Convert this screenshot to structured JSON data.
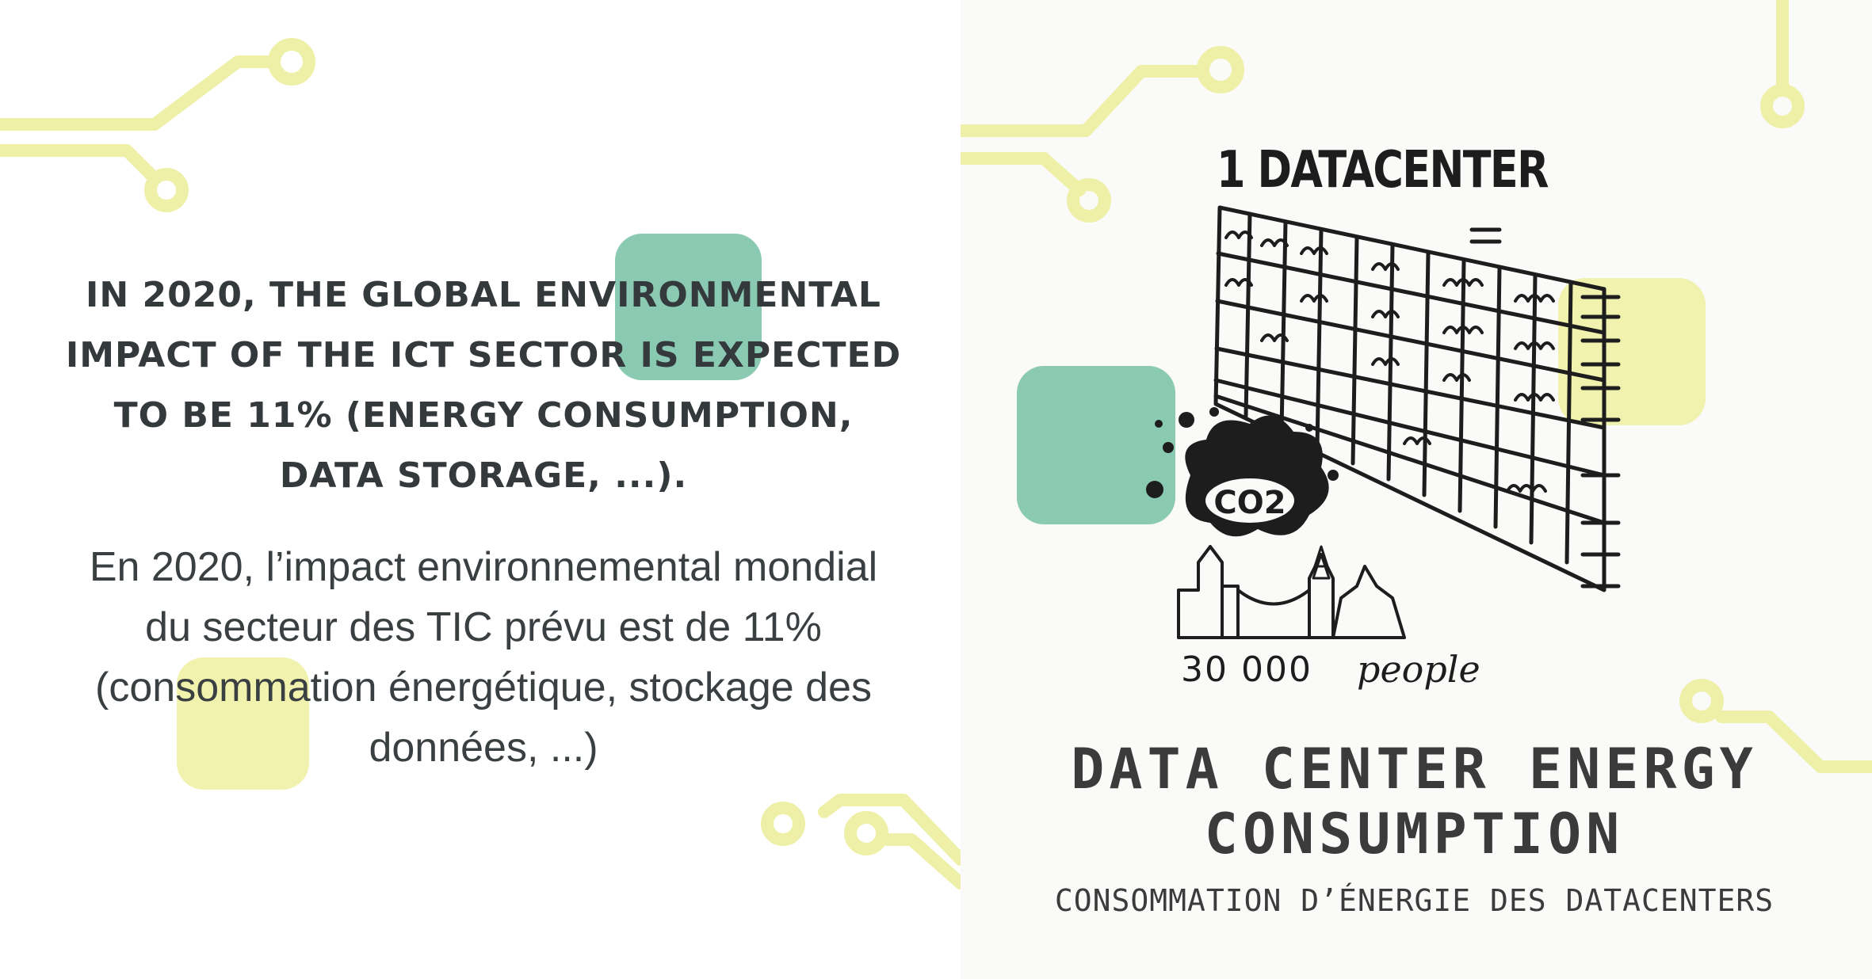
{
  "left_panel": {
    "english_text": "IN 2020, THE GLOBAL ENVIRONMENTAL IMPACT OF THE ICT SECTOR IS EXPECTED TO BE 11% (ENERGY CONSUMPTION, DATA STORAGE, ...).",
    "french_text": "En 2020, l’impact environnemental mondial du secteur des TIC prévu est de 11% (consommation énergétique, stockage des données, ...)"
  },
  "right_panel": {
    "sketch": {
      "label": "1 DATACENTER",
      "equals": "=",
      "emission_label": "CO2",
      "people_count": "30 000",
      "people_word": "people"
    },
    "title_en": "DATA CENTER ENERGY CONSUMPTION",
    "title_fr": "CONSOMMATION D’ÉNERGIE DES DATACENTERS"
  },
  "colors": {
    "text_dark": "#34393c",
    "accent_green": "#8bcab2",
    "accent_yellow": "#eff1a4",
    "circuit_yellow": "#eef0a8"
  }
}
